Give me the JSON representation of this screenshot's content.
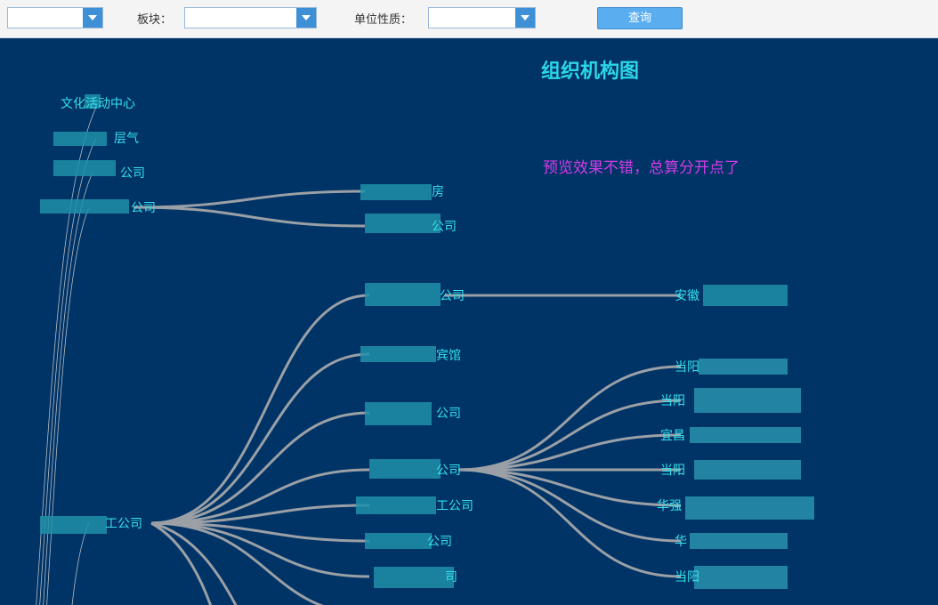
{
  "toolbar": {
    "block_label": "板块：",
    "unit_type_label": "单位性质：",
    "query_label": "查询",
    "colors": {
      "trigger": "#3d8fd6",
      "button": "#5aaef0"
    }
  },
  "chart": {
    "title": "组织机构图",
    "annotation": "预览效果不错，总算分开点了",
    "colors": {
      "background": "#003366",
      "link": "#9aa0a6",
      "label": "#35e2ee",
      "title": "#2ad6e8",
      "annotation": "#d23ce8"
    }
  },
  "tree": {
    "left_nodes": [
      "文化活动中心",
      "层气",
      "公司",
      "公司"
    ],
    "mid_upper_nodes": [
      "房",
      "公司"
    ],
    "anhui_parent": "公司",
    "anhui_child": "安徽",
    "hotel": "宾馆",
    "gong_yi": "公司",
    "main_hub": "工公司",
    "dang_hub": "公司",
    "dang_children": [
      "当阳",
      "当阳",
      "宜昌",
      "当阳",
      "华强",
      "华",
      "当阳"
    ],
    "mid_lower_nodes": [
      "工公司",
      "公司",
      "司"
    ]
  }
}
